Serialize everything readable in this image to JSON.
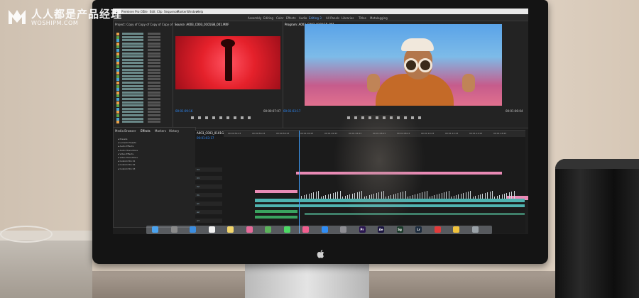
{
  "watermark": {
    "title": "人人都是产品经理",
    "url": "WOSHIPM.COM"
  },
  "menubar": {
    "items": [
      "Premiere Pro CC",
      "File",
      "Edit",
      "Clip",
      "Sequence",
      "Marker",
      "Window",
      "Help"
    ]
  },
  "workspaces": {
    "items": [
      "Assembly",
      "Editing",
      "Color",
      "Effects",
      "Audio",
      "Editing 3",
      "All Panels",
      "Libraries",
      "Titles",
      "Metalogging"
    ],
    "active_index": 5
  },
  "panels": {
    "project_tab": "Project: Copy of Copy of Copy of Copy of Motion Video",
    "source_tab": "Source: A003_C003_0101GB_001.MXF",
    "program_tab": "Program: A003_C003_0101GB_001"
  },
  "timecodes": {
    "source_current": "00:01:09:16",
    "source_duration": "00:00:07:07",
    "program_current": "00:01:03:17",
    "program_duration": "00:01:06:04",
    "timeline_current": "00:01:03:17"
  },
  "effects_panel": {
    "tabs": [
      "Media Browser",
      "Effects",
      "Markers",
      "History"
    ],
    "items": [
      "Presets",
      "Lumetri Presets",
      "Audio Effects",
      "Audio Transitions",
      "Video Effects",
      "Video Transitions",
      "Custom Bin 01",
      "Custom Bin 02",
      "Custom Bin 03"
    ]
  },
  "timeline": {
    "sequence_name": "A003_C003_0101GB_001",
    "ruler": [
      "00:00:54:23",
      "00:00:56:23",
      "00:00:58:23",
      "00:01:00:23",
      "00:01:02:23",
      "00:01:04:23",
      "00:01:06:23",
      "00:01:08:23",
      "00:01:10:23",
      "00:01:12:23",
      "00:01:14:23",
      "00:01:16:23"
    ],
    "tracks": [
      "V4",
      "V3",
      "V2",
      "V1",
      "A1",
      "A2",
      "A3"
    ]
  },
  "dock": {
    "icons": [
      {
        "name": "finder-icon",
        "color": "#4aa3f0",
        "text": ""
      },
      {
        "name": "launchpad-icon",
        "color": "#8a8a8a",
        "text": ""
      },
      {
        "name": "safari-icon",
        "color": "#3b8de0",
        "text": ""
      },
      {
        "name": "calendar-icon",
        "color": "#f2f2f2",
        "text": ""
      },
      {
        "name": "notes-icon",
        "color": "#f3d66b",
        "text": ""
      },
      {
        "name": "photos-icon",
        "color": "#e86a9a",
        "text": ""
      },
      {
        "name": "maps-icon",
        "color": "#5bb35b",
        "text": ""
      },
      {
        "name": "messages-icon",
        "color": "#4cd964",
        "text": ""
      },
      {
        "name": "itunes-icon",
        "color": "#f25f8f",
        "text": ""
      },
      {
        "name": "appstore-icon",
        "color": "#2f8df5",
        "text": ""
      },
      {
        "name": "preferences-icon",
        "color": "#8e8e93",
        "text": ""
      },
      {
        "name": "premiere-icon",
        "color": "#2a1650",
        "text": "Pr"
      },
      {
        "name": "after-effects-icon",
        "color": "#1c1640",
        "text": "Ae"
      },
      {
        "name": "speedgrade-icon",
        "color": "#1b3a2a",
        "text": "Sg"
      },
      {
        "name": "lightroom-icon",
        "color": "#1c2b3d",
        "text": "Lr"
      },
      {
        "name": "creative-cloud-icon",
        "color": "#e33a3a",
        "text": ""
      },
      {
        "name": "chrome-icon",
        "color": "#f0c33c",
        "text": ""
      },
      {
        "name": "trash-icon",
        "color": "#9aa2a8",
        "text": ""
      }
    ]
  },
  "colors": {
    "accent": "#2d8cff",
    "clip_teal": "#4fb3b0",
    "clip_pink": "#e98ab5",
    "clip_green": "#3aa35f"
  }
}
